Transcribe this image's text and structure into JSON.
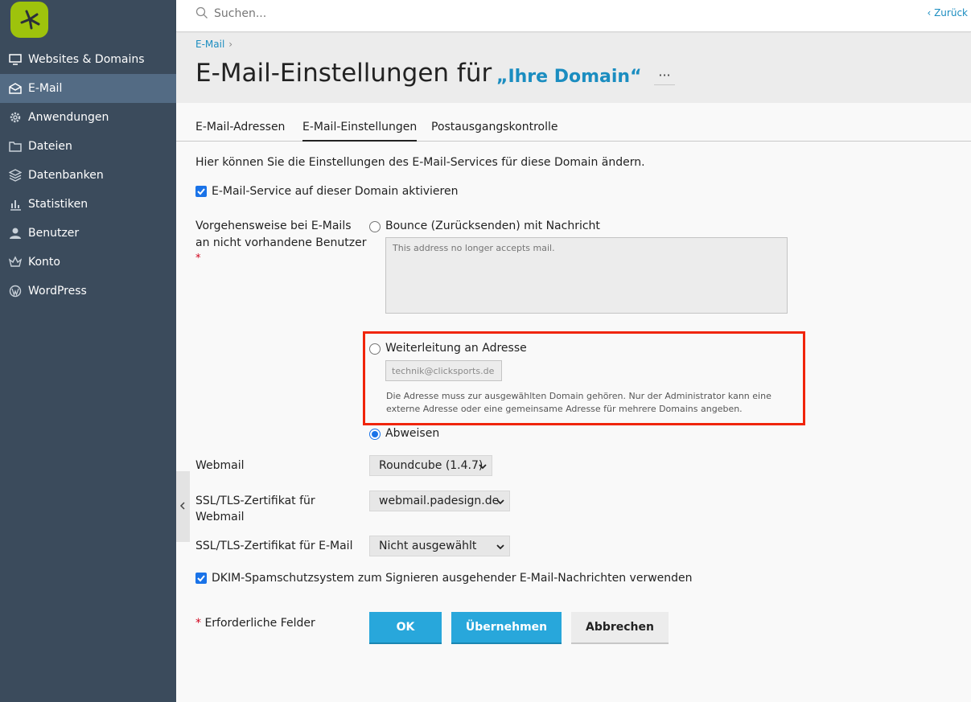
{
  "sidebar": {
    "items": [
      {
        "label": "Websites & Domains",
        "icon": "monitor-icon"
      },
      {
        "label": "E-Mail",
        "icon": "envelope-icon",
        "active": true
      },
      {
        "label": "Anwendungen",
        "icon": "gear-icon"
      },
      {
        "label": "Dateien",
        "icon": "folder-icon"
      },
      {
        "label": "Datenbanken",
        "icon": "database-stack-icon"
      },
      {
        "label": "Statistiken",
        "icon": "bar-chart-icon"
      },
      {
        "label": "Benutzer",
        "icon": "user-icon"
      },
      {
        "label": "Konto",
        "icon": "crown-icon"
      },
      {
        "label": "WordPress",
        "icon": "wordpress-icon"
      }
    ]
  },
  "search": {
    "placeholder": "Suchen..."
  },
  "back_link": "‹  Zurück",
  "breadcrumb": {
    "item": "E-Mail",
    "separator": "›"
  },
  "header": {
    "title": "E-Mail-Einstellungen für",
    "domain": "„Ihre Domain“",
    "more_label": "···"
  },
  "tabs": [
    {
      "label": "E-Mail-Adressen",
      "active": false
    },
    {
      "label": "E-Mail-Einstellungen",
      "active": true
    },
    {
      "label": "Postausgangskontrolle",
      "active": false
    }
  ],
  "form": {
    "intro": "Hier können Sie die Einstellungen des E-Mail-Services für diese Domain ändern.",
    "enable_service": {
      "label": "E-Mail-Service auf dieser Domain aktivieren",
      "checked": true
    },
    "nonexistent_label_line1": "Vorgehensweise bei E-Mails",
    "nonexistent_label_line2": "an nicht vorhandene Benutzer",
    "required_mark": "*",
    "bounce": {
      "label": "Bounce (Zurücksenden) mit Nachricht",
      "placeholder": "This address no longer accepts mail."
    },
    "forward": {
      "label": "Weiterleitung an Adresse",
      "value": "technik@clicksports.de",
      "hint": "Die Adresse muss zur ausgewählten Domain gehören. Nur der Administrator kann eine externe Adresse oder eine gemeinsame Adresse für mehrere Domains angeben."
    },
    "reject": {
      "label": "Abweisen",
      "checked": true
    },
    "webmail": {
      "label": "Webmail",
      "value": "Roundcube (1.4.7)"
    },
    "ssl_webmail": {
      "label_line1": "SSL/TLS-Zertifikat für",
      "label_line2": "Webmail",
      "value": "webmail.padesign.de"
    },
    "ssl_mail": {
      "label": "SSL/TLS-Zertifikat für E-Mail",
      "value": "Nicht ausgewählt"
    },
    "dkim": {
      "label": "DKIM-Spamschutzsystem zum Signieren ausgehender E-Mail-Nachrichten verwenden",
      "checked": true
    },
    "required_note": "Erforderliche Felder"
  },
  "buttons": {
    "ok": "OK",
    "apply": "Übernehmen",
    "cancel": "Abbrechen"
  },
  "colors": {
    "sidebar": "#3b4b5c",
    "sidebar_active": "#536b84",
    "accent": "#1b8dc0",
    "primary_button": "#28a7db",
    "highlight": "#f0250b",
    "logo": "#9ec30c"
  }
}
